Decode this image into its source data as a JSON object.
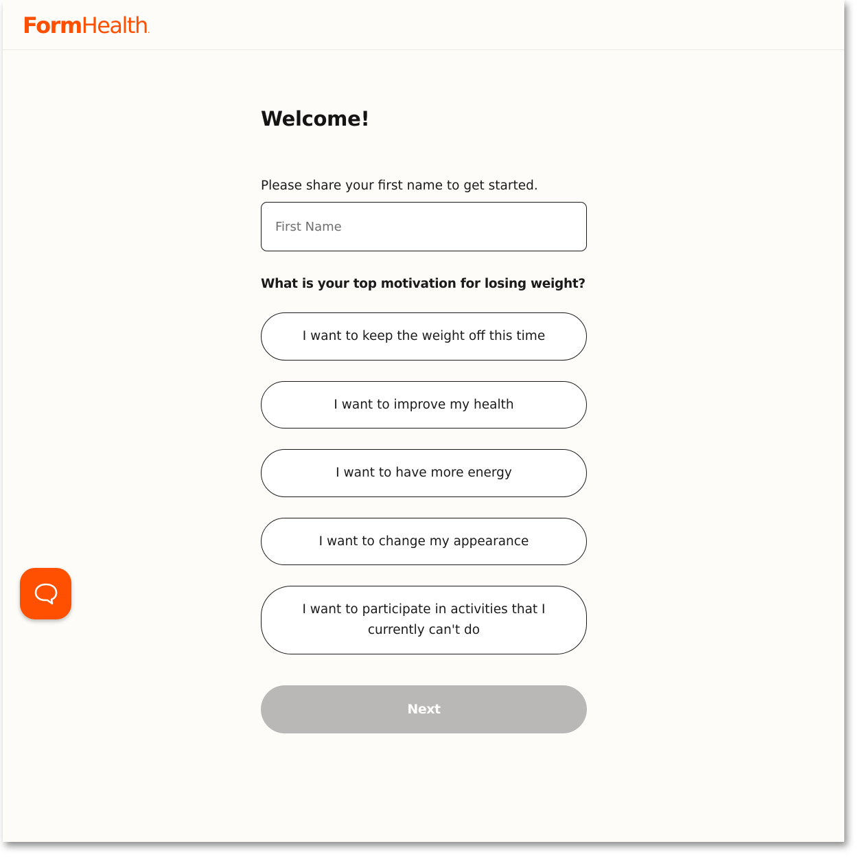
{
  "brand": {
    "logo_bold": "Form",
    "logo_regular": "Health",
    "logo_dot": ".",
    "accent_color": "#ff4f00"
  },
  "page": {
    "title": "Welcome!",
    "name_prompt": "Please share your first name to get started.",
    "name_placeholder": "First Name",
    "name_value": "",
    "question": "What is your top motivation for losing weight?",
    "options": [
      "I want to keep the weight off this time",
      "I want to improve my health",
      "I want to have more energy",
      "I want to change my appearance",
      "I want to participate in activities that I currently can't do"
    ],
    "next_label": "Next",
    "next_state": "disabled"
  },
  "chat_widget": {
    "icon": "chat-bubble-icon",
    "color": "#ff4f00"
  }
}
